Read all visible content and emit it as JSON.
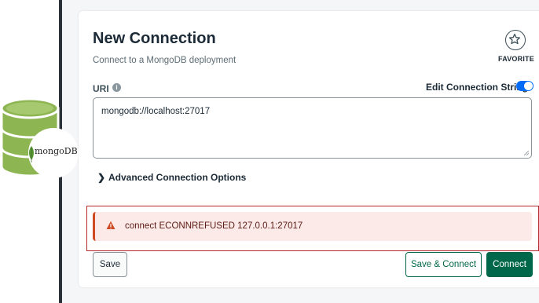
{
  "logo": {
    "text": "mongoDB"
  },
  "dialog": {
    "title": "New Connection",
    "subtitle": "Connect to a MongoDB deployment",
    "favorite_label": "FAVORITE"
  },
  "uri": {
    "label": "URI",
    "info_icon": "i",
    "value": "mongodb://localhost:27017"
  },
  "edit_toggle": {
    "label": "Edit Connection String",
    "enabled": true
  },
  "advanced": {
    "chevron": "❯",
    "label": "Advanced Connection Options"
  },
  "error": {
    "message": "connect ECONNREFUSED 127.0.0.1:27017"
  },
  "buttons": {
    "save": "Save",
    "save_connect": "Save & Connect",
    "connect": "Connect"
  },
  "colors": {
    "brand_green": "#00684a",
    "mongo_leaf": "#589636",
    "error_red": "#cf4a22",
    "toggle_blue": "#016bf8"
  }
}
